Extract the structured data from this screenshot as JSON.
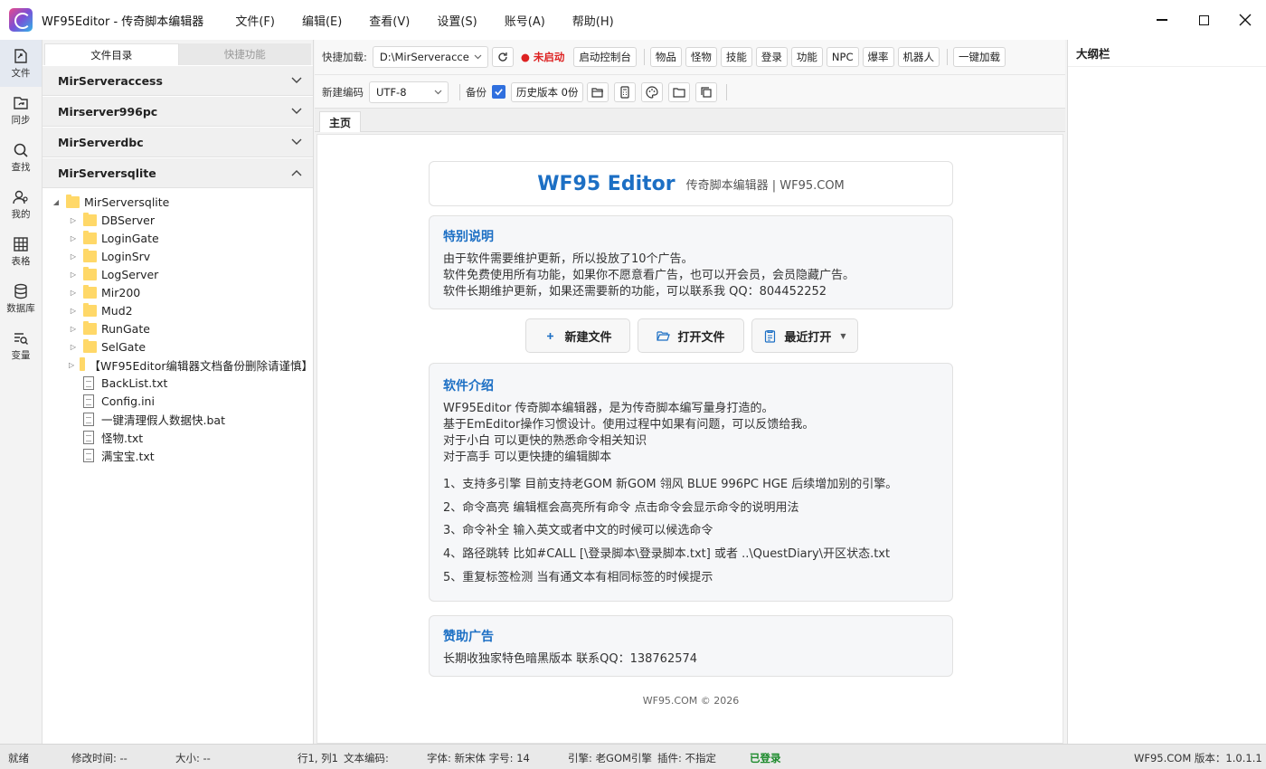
{
  "app": {
    "title": "WF95Editor - 传奇脚本编辑器"
  },
  "menu": [
    "文件(F)",
    "编辑(E)",
    "查看(V)",
    "设置(S)",
    "账号(A)",
    "帮助(H)"
  ],
  "rail": [
    {
      "label": "文件",
      "icon": "file-icon"
    },
    {
      "label": "同步",
      "icon": "sync-icon"
    },
    {
      "label": "查找",
      "icon": "search-icon"
    },
    {
      "label": "我的",
      "icon": "user-icon"
    },
    {
      "label": "表格",
      "icon": "table-icon"
    },
    {
      "label": "数据库",
      "icon": "database-icon"
    },
    {
      "label": "变量",
      "icon": "variable-icon"
    }
  ],
  "panel_tabs": [
    "文件目录",
    "快捷功能"
  ],
  "accordion": [
    "MirServeraccess",
    "Mirserver996pc",
    "MirServerdbc",
    "MirServersqlite"
  ],
  "tree": {
    "root": "MirServersqlite",
    "folders": [
      "DBServer",
      "LoginGate",
      "LoginSrv",
      "LogServer",
      "Mir200",
      "Mud2",
      "RunGate",
      "SelGate",
      "【WF95Editor编辑器文档备份删除请谨慎】"
    ],
    "files": [
      "BackList.txt",
      "Config.ini",
      "一键清理假人数据快.bat",
      "怪物.txt",
      "满宝宝.txt"
    ]
  },
  "toolbar": {
    "quick_load_label": "快捷加载:",
    "path_value": "D:\\MirServeracce",
    "status_text": "● 未启动",
    "launch_console": "启动控制台",
    "quick_buttons": [
      "物品",
      "怪物",
      "技能",
      "登录",
      "功能",
      "NPC",
      "爆率",
      "机器人"
    ],
    "one_click_load": "一键加载",
    "new_encoding_label": "新建编码",
    "encoding_value": "UTF-8",
    "backup_label": "备份",
    "history_label": "历史版本 0份"
  },
  "tabs": {
    "home": "主页"
  },
  "welcome": {
    "title": "WF95 Editor",
    "subtitle": "传奇脚本编辑器  |  WF95.COM",
    "note_title": "特别说明",
    "note_lines": [
      "由于软件需要维护更新，所以投放了10个广告。",
      "软件免费使用所有功能，如果你不愿意看广告，也可以开会员，会员隐藏广告。",
      "软件长期维护更新，如果还需要新的功能，可以联系我 QQ：804452252"
    ],
    "btn_new": "新建文件",
    "btn_open": "打开文件",
    "btn_recent": "最近打开",
    "intro_title": "软件介绍",
    "intro_lines": [
      "WF95Editor 传奇脚本编辑器，是为传奇脚本编写量身打造的。",
      "基于EmEditor操作习惯设计。使用过程中如果有问题，可以反馈给我。",
      "对于小白 可以更快的熟悉命令相关知识",
      "对于高手 可以更快捷的编辑脚本"
    ],
    "features": [
      "1、支持多引擎 目前支持老GOM 新GOM 翎风 BLUE 996PC HGE 后续增加别的引擎。",
      "2、命令高亮 编辑框会高亮所有命令 点击命令会显示命令的说明用法",
      "3、命令补全 输入英文或者中文的时候可以候选命令",
      "4、路径跳转 比如#CALL [\\登录脚本\\登录脚本.txt] 或者 ..\\QuestDiary\\开区状态.txt",
      "5、重复标签检测 当有通文本有相同标签的时候提示"
    ],
    "sponsor_title": "赞助广告",
    "sponsor_text": "长期收独家特色暗黑版本 联系QQ：138762574",
    "footer": "WF95.COM © 2026"
  },
  "outline": {
    "title": "大纲栏"
  },
  "status": {
    "ready": "就绪",
    "modified": "修改时间: --",
    "size": "大小: --",
    "position": "行1, 列1",
    "encoding": "文本编码:",
    "font": "字体: 新宋体  字号: 14",
    "engine": "引擎: 老GOM引擎",
    "plugin": "插件: 不指定",
    "login": "已登录",
    "version": "WF95.COM  版本：1.0.1.1"
  },
  "colors": {
    "accent": "#1c6fc4",
    "stopped": "#dd2222",
    "logged_in": "#1a8a2a"
  }
}
